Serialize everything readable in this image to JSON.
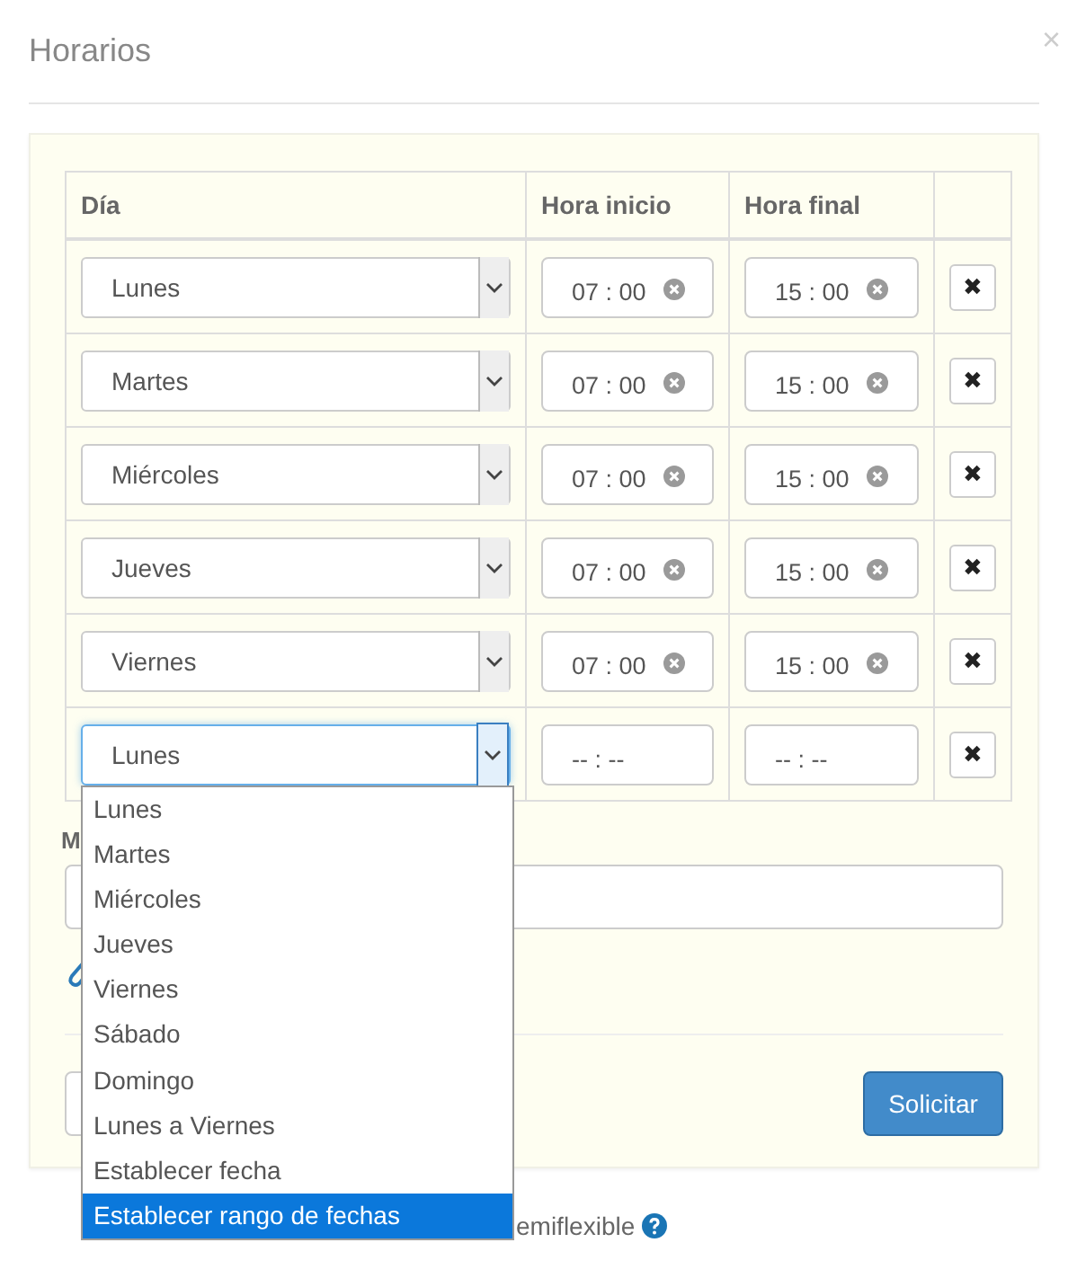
{
  "modal": {
    "title": "Horarios",
    "close": "×"
  },
  "table": {
    "columns": [
      "Día",
      "Hora inicio",
      "Hora final"
    ],
    "rows": [
      {
        "day": "Lunes",
        "start": "07 : 00",
        "end": "15 : 00",
        "open": false,
        "remove": "✖"
      },
      {
        "day": "Martes",
        "start": "07 : 00",
        "end": "15 : 00",
        "open": false,
        "remove": "✖"
      },
      {
        "day": "Miércoles",
        "start": "07 : 00",
        "end": "15 : 00",
        "open": false,
        "remove": "✖"
      },
      {
        "day": "Jueves",
        "start": "07 : 00",
        "end": "15 : 00",
        "open": false,
        "remove": "✖"
      },
      {
        "day": "Viernes",
        "start": "07 : 00",
        "end": "15 : 00",
        "open": false,
        "remove": "✖"
      },
      {
        "day": "Lunes",
        "start": "-- : --",
        "end": "-- : --",
        "open": true,
        "remove": "✖"
      }
    ]
  },
  "dropdown": {
    "options": [
      {
        "label": "Lunes",
        "selected": false
      },
      {
        "label": "Martes",
        "selected": false
      },
      {
        "label": "Miércoles",
        "selected": false
      },
      {
        "label": "Jueves",
        "selected": false
      },
      {
        "label": "Viernes",
        "selected": false
      },
      {
        "label": "Sábado",
        "selected": false
      },
      {
        "label": "Domingo",
        "selected": false
      },
      {
        "label": "Lunes a Viernes",
        "selected": false
      },
      {
        "label": "Establecer fecha",
        "selected": false
      },
      {
        "label": "Establecer rango de fechas",
        "selected": true
      }
    ]
  },
  "field_label": "M",
  "submit": "Solicitar",
  "footer_text": "emiflexible"
}
